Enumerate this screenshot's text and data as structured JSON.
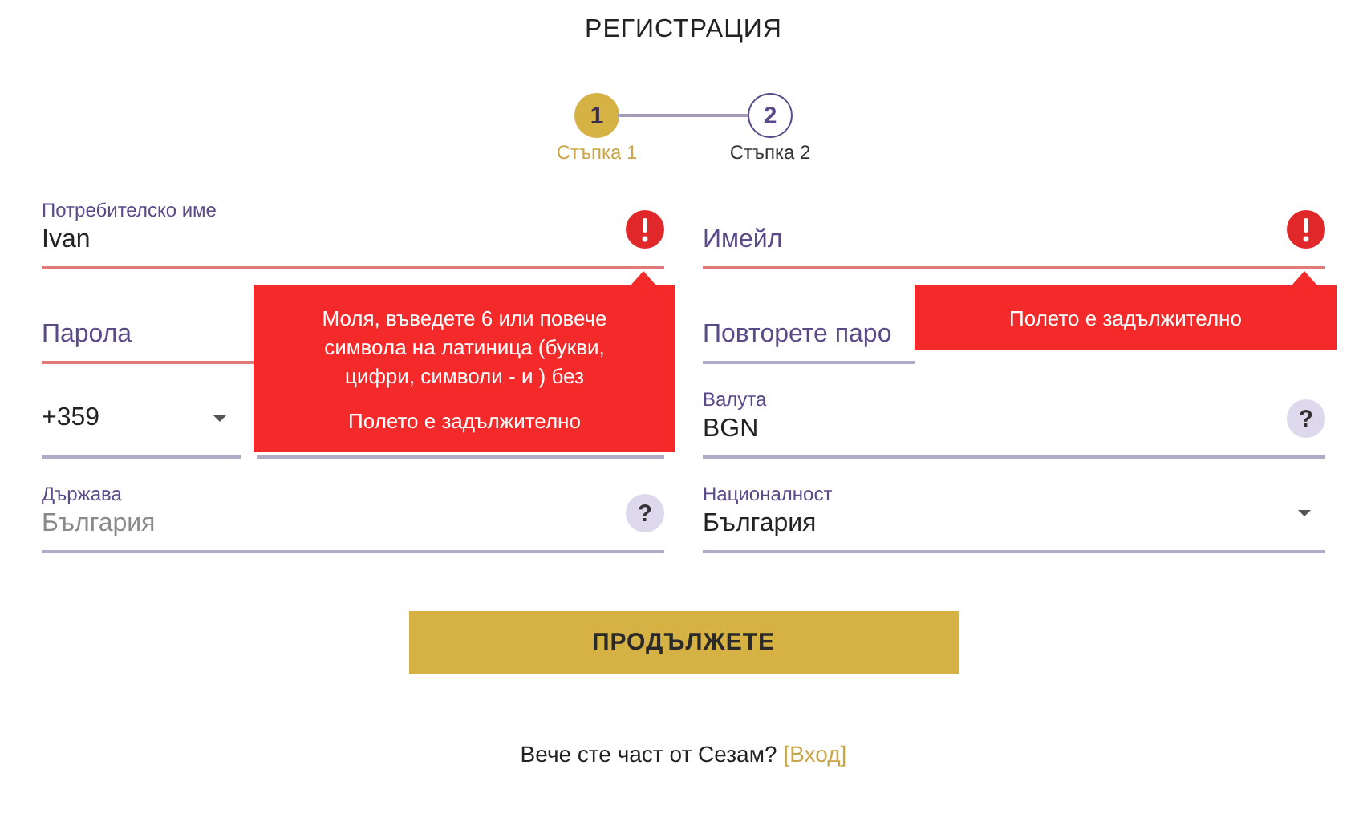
{
  "title": "РЕГИСТРАЦИЯ",
  "steps": [
    {
      "number": "1",
      "label": "Стъпка 1",
      "selected": true
    },
    {
      "number": "2",
      "label": "Стъпка 2",
      "selected": false
    }
  ],
  "fields": [
    {
      "kind": "text",
      "label": "Потребителско име",
      "value": "Ivan",
      "error": true,
      "tooltip": [
        "Моля, въведете 6 или повече символа на латиница (букви, цифри, символи - и ) без",
        "Полето е задължително"
      ]
    },
    {
      "kind": "text",
      "placeholder": "Имейл",
      "error": true,
      "tooltip": [
        "Полето е задължително"
      ]
    },
    {
      "kind": "text",
      "placeholder": "Парола",
      "error": true
    },
    {
      "kind": "text",
      "placeholder": "Повторете паро",
      "error": false
    },
    {
      "kind": "phone",
      "value": "+359"
    },
    {
      "kind": "text",
      "label": "Валута",
      "value": "BGN",
      "error": false,
      "help": "?"
    },
    {
      "kind": "text",
      "label": "Държава",
      "value": "България",
      "error": false,
      "disabled": true,
      "help": "?"
    },
    {
      "kind": "text",
      "label": "Националност",
      "value": "България",
      "error": false,
      "dropdown": true
    }
  ],
  "button": "ПРОДЪЛЖЕТЕ",
  "footer": {
    "text": "Вече сте част от Сезам?",
    "link": "[Вход]"
  }
}
